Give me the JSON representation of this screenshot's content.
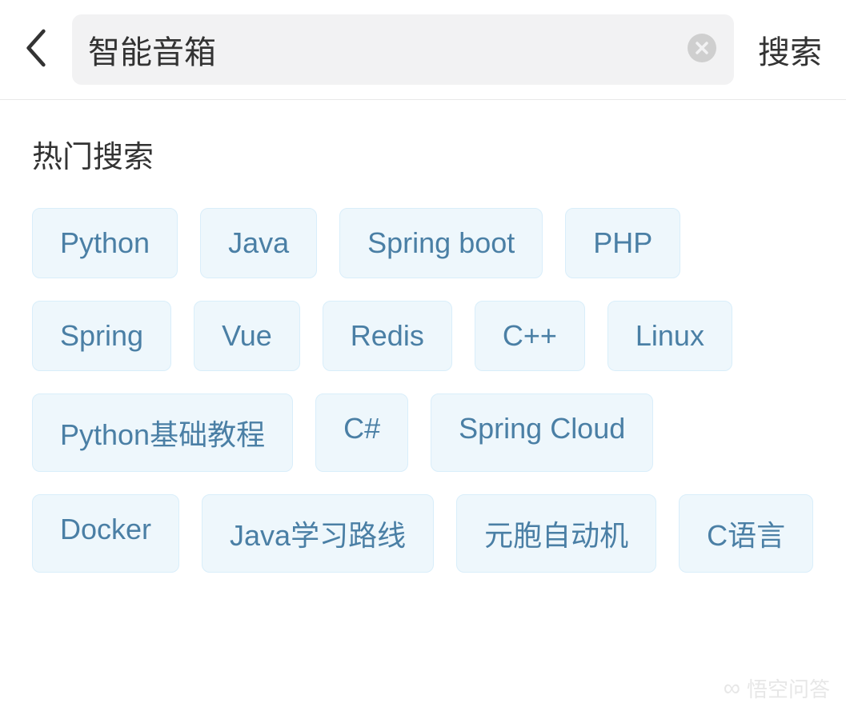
{
  "header": {
    "search_value": "智能音箱",
    "search_action_label": "搜索"
  },
  "section": {
    "title": "热门搜索",
    "tags": [
      "Python",
      "Java",
      "Spring boot",
      "PHP",
      "Spring",
      "Vue",
      "Redis",
      "C++",
      "Linux",
      "Python基础教程",
      "C#",
      "Spring Cloud",
      "Docker",
      "Java学习路线",
      "元胞自动机",
      "C语言"
    ]
  },
  "watermark": {
    "text": "悟空问答"
  }
}
